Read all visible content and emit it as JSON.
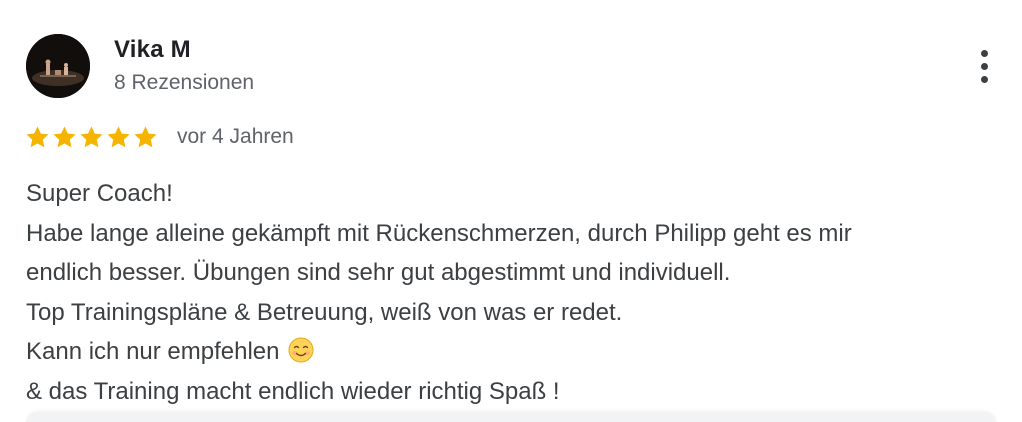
{
  "review": {
    "reviewer_name": "Vika M",
    "review_count": "8 Rezensionen",
    "rating": 5,
    "rating_max": 5,
    "star_color": "#f4b400",
    "date": "vor 4 Jahren",
    "text_lines": [
      "Super Coach!",
      "Habe lange alleine gekämpft mit Rückenschmerzen, durch Philipp geht es mir",
      "endlich besser. Übungen sind sehr gut abgestimmt und individuell.",
      "Top Trainingspläne & Betreuung, weiß von was er redet.",
      "Kann ich nur empfehlen",
      "& das Training macht endlich wieder richtig Spaß !"
    ],
    "emoji_icon": "smiling-face-icon"
  },
  "actions": {
    "more_icon": "vertical-dots-icon"
  }
}
